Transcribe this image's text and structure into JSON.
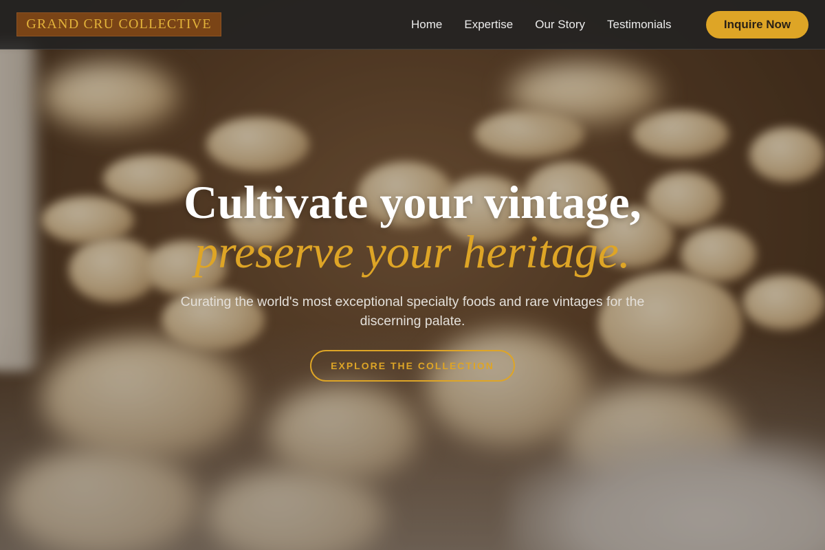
{
  "header": {
    "logo_text": "GRAND CRU COLLECTIVE",
    "nav_items": [
      "Home",
      "Expertise",
      "Our Story",
      "Testimonials"
    ],
    "cta_label": "Inquire Now"
  },
  "hero": {
    "headline_line1": "Cultivate your vintage,",
    "headline_line2": "preserve your heritage.",
    "subtext": "Curating the world's most exceptional specialty foods and rare vintages for the discerning palate.",
    "button_label": "EXPLORE THE COLLECTION"
  },
  "colors": {
    "accent": "#dea526",
    "logo_bg": "#7a4416",
    "header_bg": "#222222"
  }
}
